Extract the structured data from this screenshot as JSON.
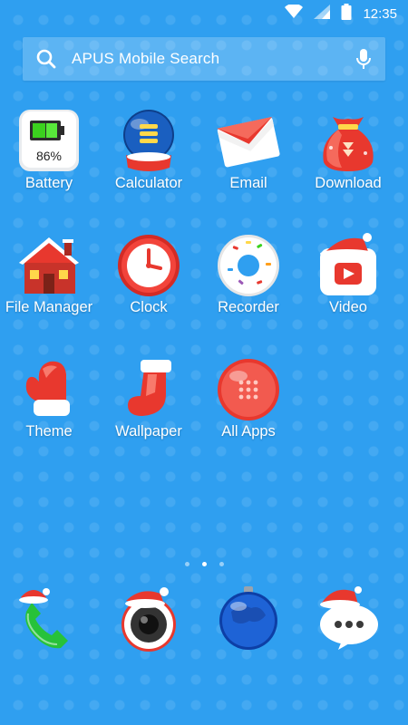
{
  "status_bar": {
    "time": "12:35",
    "icons": [
      "wifi-icon",
      "signal-icon",
      "battery-icon"
    ]
  },
  "search": {
    "label": "APUS Mobile Search",
    "icons": [
      "search-icon",
      "mic-icon"
    ]
  },
  "apps": [
    {
      "label": "Battery",
      "icon": "battery-icon",
      "badge": "86%"
    },
    {
      "label": "Calculator",
      "icon": "snow-globe-icon"
    },
    {
      "label": "Email",
      "icon": "envelope-icon"
    },
    {
      "label": "Download",
      "icon": "gift-sack-icon"
    },
    {
      "label": "File Manager",
      "icon": "house-icon"
    },
    {
      "label": "Clock",
      "icon": "clock-icon"
    },
    {
      "label": "Recorder",
      "icon": "donut-icon"
    },
    {
      "label": "Video",
      "icon": "video-play-icon"
    },
    {
      "label": "Theme",
      "icon": "mitten-icon"
    },
    {
      "label": "Wallpaper",
      "icon": "stocking-icon"
    },
    {
      "label": "All Apps",
      "icon": "ornament-grid-icon"
    }
  ],
  "page_indicator": {
    "count": 3,
    "active_index": 1
  },
  "dock": [
    {
      "icon": "phone-icon"
    },
    {
      "icon": "camera-icon"
    },
    {
      "icon": "browser-globe-icon"
    },
    {
      "icon": "messages-icon"
    }
  ],
  "colors": {
    "background": "#2f9ff0",
    "text": "#ffffff",
    "accent_red": "#e8382e"
  }
}
